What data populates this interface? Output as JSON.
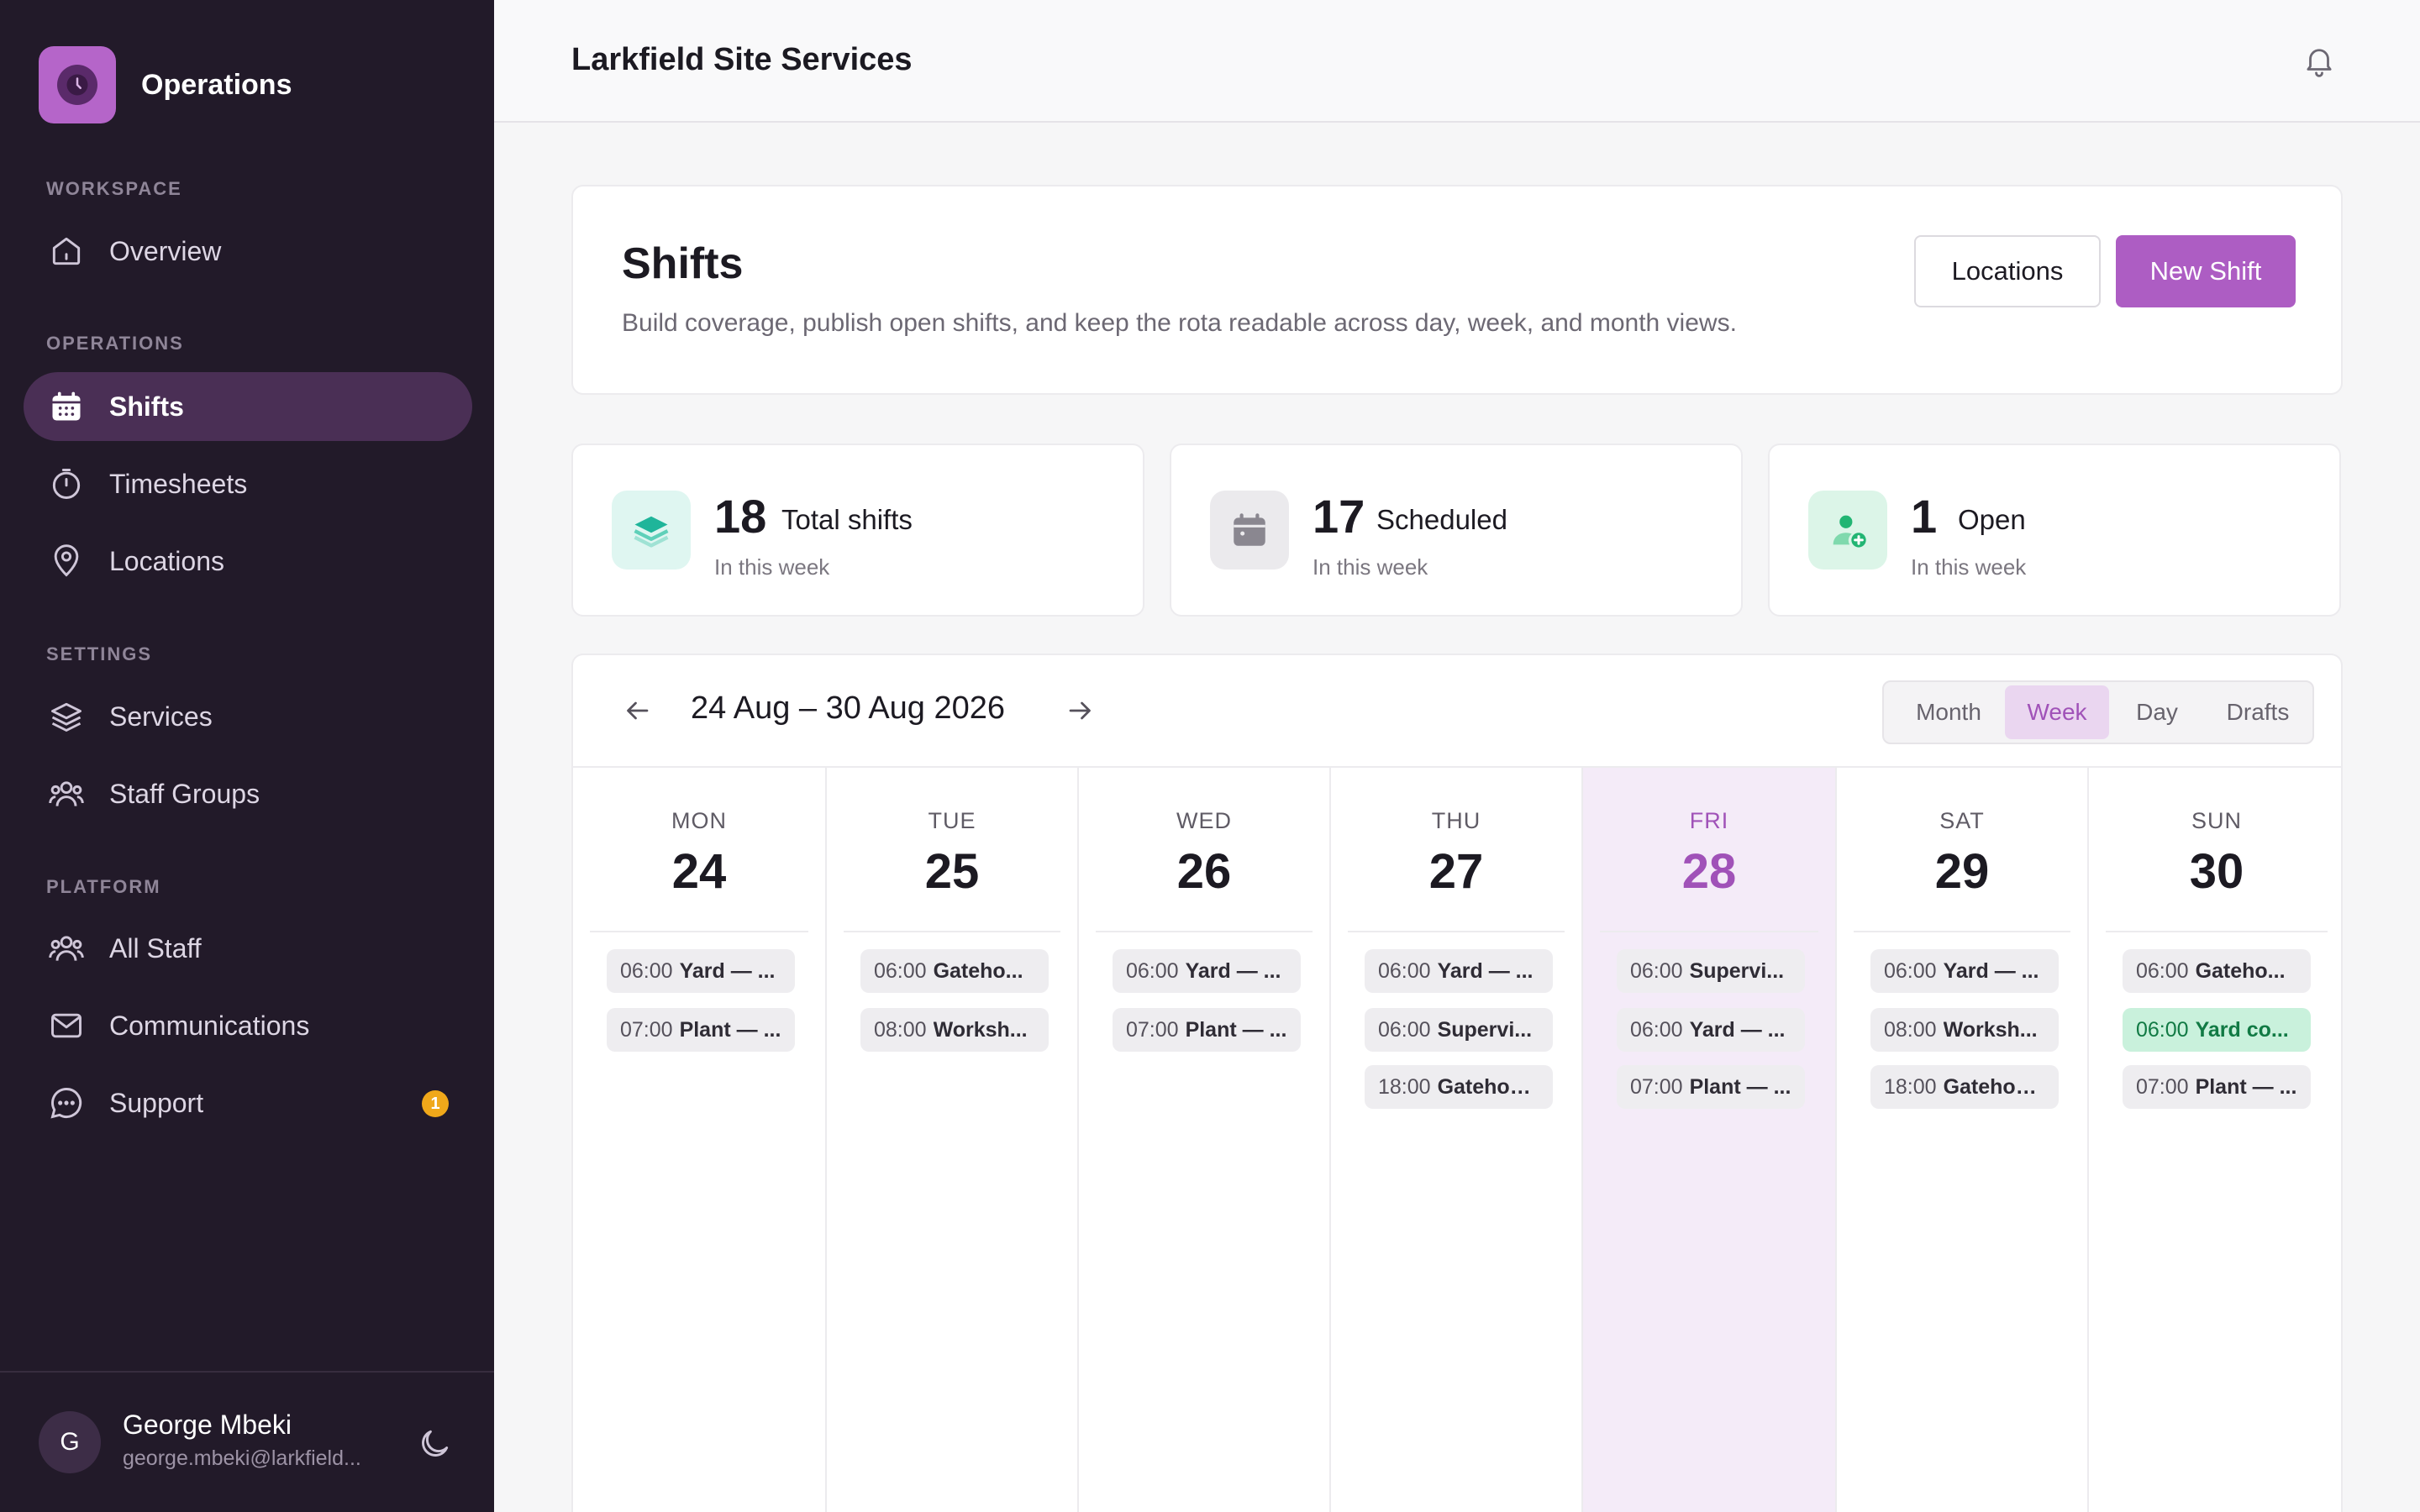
{
  "sidebar": {
    "brand": "Operations",
    "sections": [
      {
        "label": "WORKSPACE",
        "items": [
          {
            "label": "Overview",
            "icon": "home-icon"
          }
        ]
      },
      {
        "label": "OPERATIONS",
        "items": [
          {
            "label": "Shifts",
            "icon": "calendar-icon",
            "active": true
          },
          {
            "label": "Timesheets",
            "icon": "stopwatch-icon"
          },
          {
            "label": "Locations",
            "icon": "map-pin-icon"
          }
        ]
      },
      {
        "label": "SETTINGS",
        "items": [
          {
            "label": "Services",
            "icon": "layers-icon"
          },
          {
            "label": "Staff Groups",
            "icon": "users-icon"
          }
        ]
      },
      {
        "label": "PLATFORM",
        "items": [
          {
            "label": "All Staff",
            "icon": "users-icon"
          },
          {
            "label": "Communications",
            "icon": "mail-icon"
          },
          {
            "label": "Support",
            "icon": "chat-icon",
            "badge": "1"
          }
        ]
      }
    ],
    "user": {
      "initial": "G",
      "name": "George Mbeki",
      "email": "george.mbeki@larkfield..."
    }
  },
  "topbar": {
    "title": "Larkfield Site Services"
  },
  "header": {
    "title": "Shifts",
    "description": "Build coverage, publish open shifts, and keep the rota readable across day, week, and month views.",
    "locations_label": "Locations",
    "new_shift_label": "New Shift"
  },
  "stats": [
    {
      "value": "18",
      "label": "Total shifts",
      "sub": "In this week",
      "icon": "layers-icon",
      "color": "#1fb59a"
    },
    {
      "value": "17",
      "label": "Scheduled",
      "sub": "In this week",
      "icon": "calendar-icon",
      "color": "#8a8790"
    },
    {
      "value": "1",
      "label": "Open",
      "sub": "In this week",
      "icon": "user-plus-icon",
      "color": "#22b573"
    }
  ],
  "calendar": {
    "range": "24 Aug – 30 Aug 2026",
    "views": [
      "Month",
      "Week",
      "Day",
      "Drafts"
    ],
    "active_view": "Week",
    "days": [
      {
        "name": "MON",
        "num": "24",
        "shifts": [
          {
            "time": "06:00",
            "name": "Yard — ..."
          },
          {
            "time": "07:00",
            "name": "Plant — ..."
          }
        ]
      },
      {
        "name": "TUE",
        "num": "25",
        "shifts": [
          {
            "time": "06:00",
            "name": "Gateho..."
          },
          {
            "time": "08:00",
            "name": "Worksh..."
          }
        ]
      },
      {
        "name": "WED",
        "num": "26",
        "shifts": [
          {
            "time": "06:00",
            "name": "Yard — ..."
          },
          {
            "time": "07:00",
            "name": "Plant — ..."
          }
        ]
      },
      {
        "name": "THU",
        "num": "27",
        "shifts": [
          {
            "time": "06:00",
            "name": "Yard — ..."
          },
          {
            "time": "06:00",
            "name": "Supervi..."
          },
          {
            "time": "18:00",
            "name": "Gatehou..."
          }
        ]
      },
      {
        "name": "FRI",
        "num": "28",
        "today": true,
        "shifts": [
          {
            "time": "06:00",
            "name": "Supervi..."
          },
          {
            "time": "06:00",
            "name": "Yard — ..."
          },
          {
            "time": "07:00",
            "name": "Plant — ..."
          }
        ]
      },
      {
        "name": "SAT",
        "num": "29",
        "shifts": [
          {
            "time": "06:00",
            "name": "Yard — ..."
          },
          {
            "time": "08:00",
            "name": "Worksh..."
          },
          {
            "time": "18:00",
            "name": "Gatehou..."
          }
        ]
      },
      {
        "name": "SUN",
        "num": "30",
        "shifts": [
          {
            "time": "06:00",
            "name": "Gateho..."
          },
          {
            "time": "06:00",
            "name": "Yard co...",
            "open": true
          },
          {
            "time": "07:00",
            "name": "Plant — ..."
          }
        ]
      }
    ]
  },
  "colors": {
    "accent": "#ad5dc3",
    "sidebar_bg": "#221a29",
    "open_shift": "#c9f1dc"
  }
}
